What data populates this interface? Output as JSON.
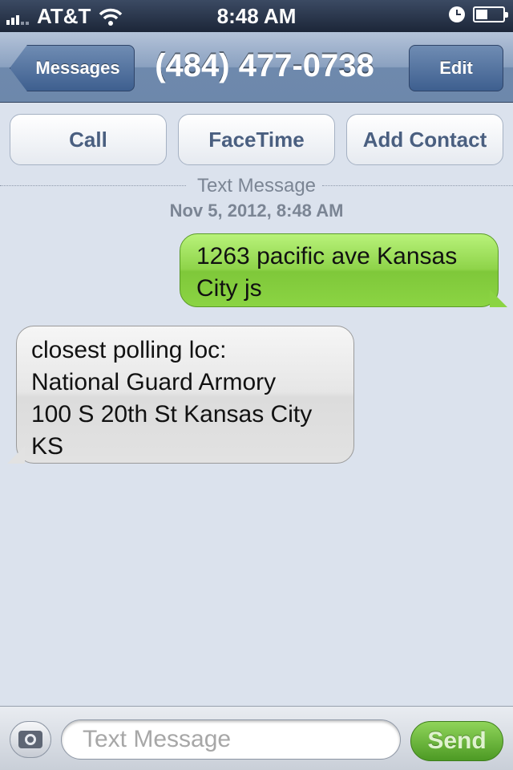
{
  "status_bar": {
    "carrier": "AT&T",
    "time": "8:48 AM",
    "icons": [
      "signal-bars-icon",
      "wifi-icon",
      "clock-icon",
      "battery-icon"
    ]
  },
  "nav": {
    "back_label": "Messages",
    "title": "(484) 477-0738",
    "edit_label": "Edit"
  },
  "actions": {
    "call": "Call",
    "facetime": "FaceTime",
    "add_contact": "Add Contact"
  },
  "conversation": {
    "header_label": "Text Message",
    "date": "Nov 5, 2012, 8:48 AM",
    "messages": [
      {
        "direction": "sent",
        "lines": [
          "1263 pacific ave Kansas",
          "City js"
        ]
      },
      {
        "direction": "received",
        "lines": [
          "closest polling loc:",
          "National Guard Armory",
          "100 S 20th St Kansas City",
          "KS"
        ]
      }
    ]
  },
  "composer": {
    "placeholder": "Text Message",
    "send_label": "Send",
    "camera_icon": "camera-icon"
  },
  "colors": {
    "sent_bubble": "#8fd44a",
    "received_bubble": "#e6e6e6",
    "background": "#dbe2ed",
    "nav_bar": "#8aa1c0"
  }
}
